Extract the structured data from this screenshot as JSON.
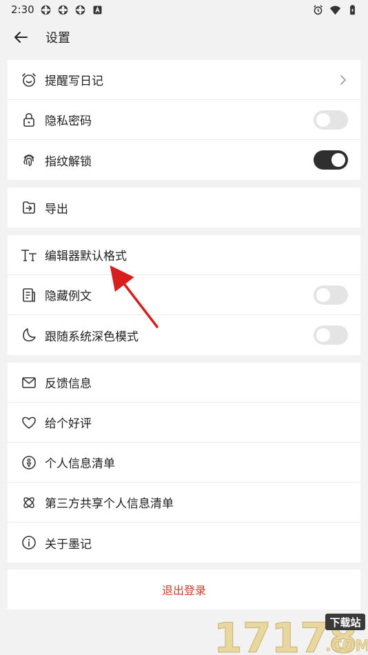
{
  "status_bar": {
    "time": "2:30",
    "icons": [
      "notification-icon",
      "notification-icon",
      "notification-icon",
      "a-icon",
      "alarm-icon",
      "wifi-icon",
      "battery-icon"
    ]
  },
  "header": {
    "title": "设置",
    "back_icon": "arrow-left-icon"
  },
  "groups": [
    {
      "items": [
        {
          "label": "提醒写日记",
          "icon": "alarm-clock-icon",
          "control": "chevron"
        },
        {
          "label": "隐私密码",
          "icon": "lock-icon",
          "control": "toggle",
          "on": false
        },
        {
          "label": "指纹解锁",
          "icon": "fingerprint-icon",
          "control": "toggle",
          "on": true
        }
      ]
    },
    {
      "items": [
        {
          "label": "导出",
          "icon": "export-icon",
          "control": "none"
        }
      ]
    },
    {
      "items": [
        {
          "label": "编辑器默认格式",
          "icon": "text-format-icon",
          "control": "none"
        },
        {
          "label": "隐藏例文",
          "icon": "document-icon",
          "control": "toggle",
          "on": false
        },
        {
          "label": "跟随系统深色模式",
          "icon": "moon-icon",
          "control": "toggle",
          "on": false
        }
      ]
    },
    {
      "items": [
        {
          "label": "反馈信息",
          "icon": "mail-icon",
          "control": "none"
        },
        {
          "label": "给个好评",
          "icon": "heart-icon",
          "control": "none"
        },
        {
          "label": "个人信息清单",
          "icon": "person-info-icon",
          "control": "none"
        },
        {
          "label": "第三方共享个人信息清单",
          "icon": "share-icon",
          "control": "none"
        },
        {
          "label": "关于墨记",
          "icon": "info-icon",
          "control": "none"
        }
      ]
    }
  ],
  "logout": {
    "label": "退出登录"
  },
  "colors": {
    "accent_red": "#d23a2a",
    "toggle_on": "#2f2f2f",
    "toggle_off": "#e4e4e4",
    "background": "#f2f2f2"
  },
  "watermark": {
    "number": "17178",
    "badge": "下载站",
    "suffix": ".COM"
  }
}
